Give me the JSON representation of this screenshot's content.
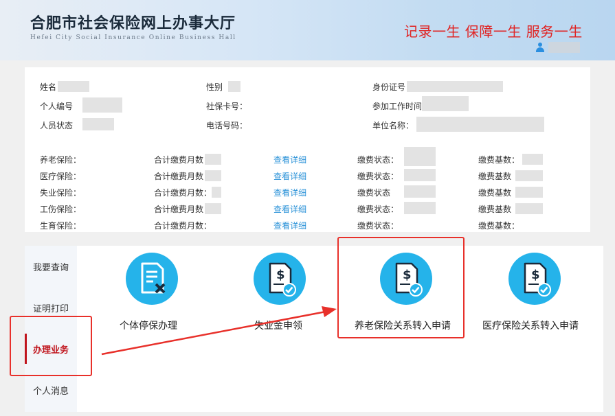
{
  "header": {
    "title_cn": "合肥市社会保险网上办事大厅",
    "title_en": "Hefei City Social Insurance Online Business Hall",
    "slogan": "记录一生 保障一生 服务一生"
  },
  "personal_info": {
    "name_label": "姓名",
    "gender_label": "性别",
    "id_label": "身份证号",
    "personal_no_label": "个人编号",
    "card_label": "社保卡号：",
    "work_start_label": "参加工作时间",
    "status_label": "人员状态",
    "phone_label": "电话号码：",
    "employer_label": "单位名称："
  },
  "insurance_rows": [
    {
      "type": "养老保险：",
      "months_label": "合计缴费月数",
      "link": "查看详细",
      "status_label": "缴费状态：",
      "base_label": "缴费基数："
    },
    {
      "type": "医疗保险：",
      "months_label": "合计缴费月数",
      "link": "查看详细",
      "status_label": "缴费状态：",
      "base_label": "缴费基数"
    },
    {
      "type": "失业保险：",
      "months_label": "合计缴费月数：",
      "link": "查看详细",
      "status_label": "缴费状态",
      "base_label": "缴费基数"
    },
    {
      "type": "工伤保险：",
      "months_label": "合计缴费月数",
      "link": "查看详细",
      "status_label": "缴费状态：",
      "base_label": "缴费基数"
    },
    {
      "type": "生育保险：",
      "months_label": "合计缴费月数：",
      "link": "查看详细",
      "status_label": "缴费状态：",
      "base_label": "缴费基数："
    }
  ],
  "sidebar": {
    "items": [
      {
        "label": "我要查询"
      },
      {
        "label": "证明打印"
      },
      {
        "label": "办理业务"
      },
      {
        "label": "个人消息"
      }
    ]
  },
  "services": [
    {
      "label": "个体停保办理",
      "icon": "document-x-icon"
    },
    {
      "label": "失业金申领",
      "icon": "dollar-document-check-icon"
    },
    {
      "label": "养老保险关系转入申请",
      "icon": "dollar-document-check-icon"
    },
    {
      "label": "医疗保险关系转入申请",
      "icon": "dollar-document-check-icon"
    }
  ],
  "colors": {
    "accent_red": "#e02424",
    "icon_blue": "#25b3ea",
    "link_blue": "#2a92d8",
    "active_red": "#c0141c"
  }
}
